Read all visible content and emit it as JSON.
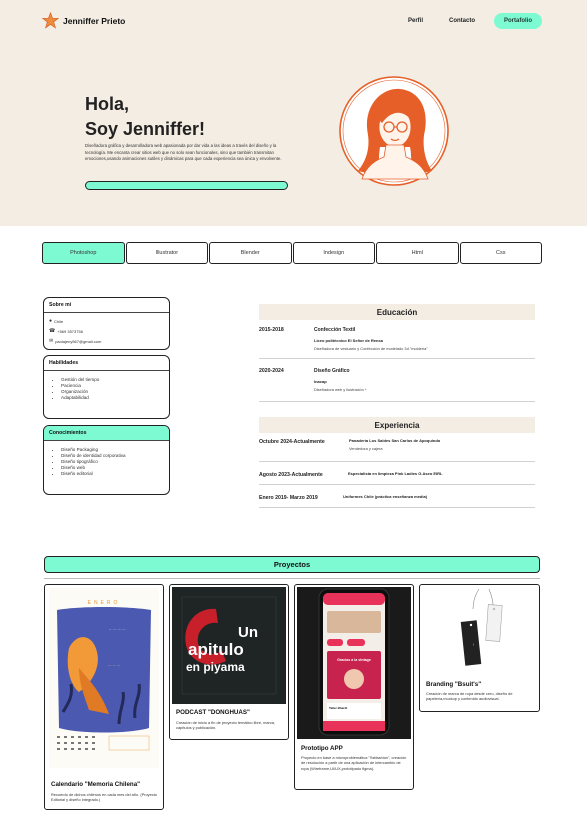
{
  "brand": {
    "name": "Jenniffer Prieto",
    "accent": "#7dfad2",
    "star_color": "#f08a3c"
  },
  "nav": {
    "perfil": "Perfil",
    "contacto": "Contacto",
    "portafolio": "Portafolio"
  },
  "hero": {
    "line1": "Hola,",
    "line2": "Soy Jenniffer!",
    "description": "Diseñadora gráfica y desarrolladora web apasionada por dar vida a las ideas a través del diseño y la tecnología. Me encanta crear sitios web que no solo sean funcionales, sino que también transmitan emociones,usando animaciones sutiles y dinámicas para que cada experiencia sea única y envolvente."
  },
  "tabs": [
    "Photoshop",
    "Illustrator",
    "Blender",
    "Indesign",
    "Html",
    "Css"
  ],
  "sobre_mi": {
    "title": "Sobre mi",
    "location": "Chile",
    "phone": "+569 3573756",
    "email": "paolajeny567@gmail.com"
  },
  "habilidades": {
    "title": "Habilidades",
    "items": [
      "Gestión del tiempo",
      "Paciencia",
      "Organización",
      "Adaptabilidad"
    ]
  },
  "conocimientos": {
    "title": "Conocimientos",
    "items": [
      "Diseño Packaging",
      "Diseño de identidad corporativa",
      "Diseño tipográfico",
      "Diseño web",
      "Diseño editorial"
    ]
  },
  "educacion": {
    "title": "Educación",
    "entries": [
      {
        "years": "2015-2018",
        "title": "Confección Textil",
        "school": "Liceo politécnico El Señor de Renca",
        "desc": "Diseñadora de vestuario y Confección de modelado 3d \"moldería\""
      },
      {
        "years": "2020-2024",
        "title": "Diseño Gráfico",
        "school": "Inacap",
        "desc": "Diseñadora web y ilustración *"
      }
    ]
  },
  "experiencia": {
    "title": "Experiencia",
    "entries": [
      {
        "date": "Octubre 2024-Actualmente",
        "company": "Panadería Los Saldes San Carlos de Apoquindo",
        "role": "Vendedora y cajera"
      },
      {
        "date": "Agosto 2023-Actualmente",
        "company": "Especialista en limpieza Pink Ladies G.Aseo EIRL",
        "role": ""
      },
      {
        "date": "Enero 2019- Marzo 2019",
        "company": "Uniformes Chile (práctica enseñanza media)",
        "role": ""
      }
    ]
  },
  "proyectos": {
    "title": "Proyectos",
    "items": [
      {
        "title": "Calendario \"Memoria Chilena\"",
        "desc": "Recuerdo de dichos chilenos en cada mes del año. (Proyecto Editorial y diseño integrado.)",
        "img_text": "ENERO"
      },
      {
        "title": "PODCAST \"DONGHUAS\"",
        "desc": "Creación de inicio a fin de proyecto temático libre, marca, capítulos y publicación.",
        "img_text_1": "Un",
        "img_text_2": "apitulo",
        "img_text_3": "en piyama"
      },
      {
        "title": "Prototipo APP",
        "desc": "Proyecto en base a microproblemática \"Sstfashion\", creación de resolución a partir de una aplicación de intercambio de ropa (Wireframe,UI/UX,prototipado figma).",
        "img_text_1": "Gracias a la vintage",
        "img_text_2": "Taller Bhardt"
      },
      {
        "title": "Branding \"Bsuit's\"",
        "desc": "Creación de marca de ropa desde cero, diseño de papelería,mockup y contenido audiovisual."
      }
    ]
  }
}
